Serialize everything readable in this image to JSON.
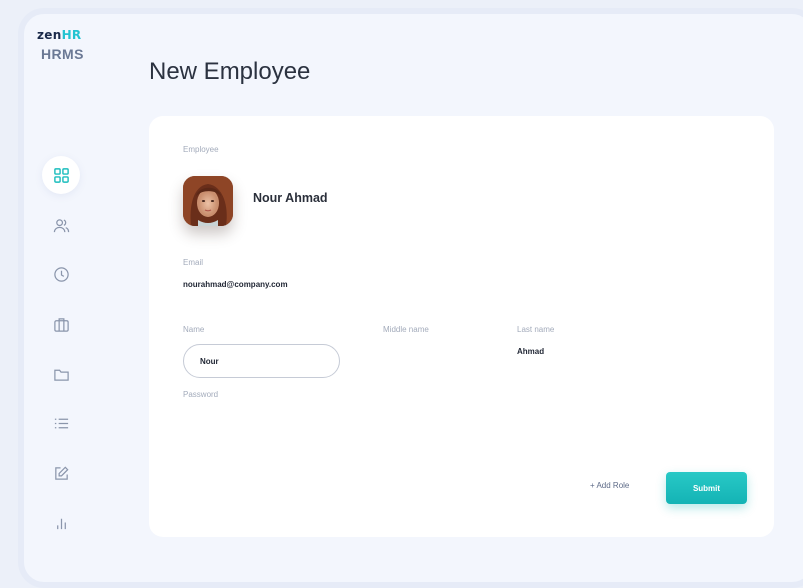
{
  "brand": {
    "logo_main": "zen",
    "logo_accent": "HR",
    "product": "HRMS"
  },
  "sidebar": {
    "items": [
      {
        "icon": "dashboard-grid-icon",
        "active": true
      },
      {
        "icon": "users-icon",
        "active": false
      },
      {
        "icon": "clock-icon",
        "active": false
      },
      {
        "icon": "briefcase-icon",
        "active": false
      },
      {
        "icon": "folder-icon",
        "active": false
      },
      {
        "icon": "list-icon",
        "active": false
      },
      {
        "icon": "edit-icon",
        "active": false
      },
      {
        "icon": "bar-chart-icon",
        "active": false
      }
    ]
  },
  "page": {
    "title": "New Employee"
  },
  "form": {
    "employee_label": "Employee",
    "employee_name": "Nour Ahmad",
    "email_label": "Email",
    "email_value": "nourahmad@company.com",
    "name_label": "Name",
    "name_value": "Nour",
    "middle_name_label": "Middle name",
    "last_name_label": "Last name",
    "last_name_value": "Ahmad",
    "password_label": "Password",
    "add_role_label": "+ Add Role",
    "submit_label": "Submit"
  },
  "colors": {
    "accent": "#1bbdbd",
    "logo_accent": "#22c3d1",
    "background": "#f3f6fd",
    "card": "#ffffff"
  }
}
